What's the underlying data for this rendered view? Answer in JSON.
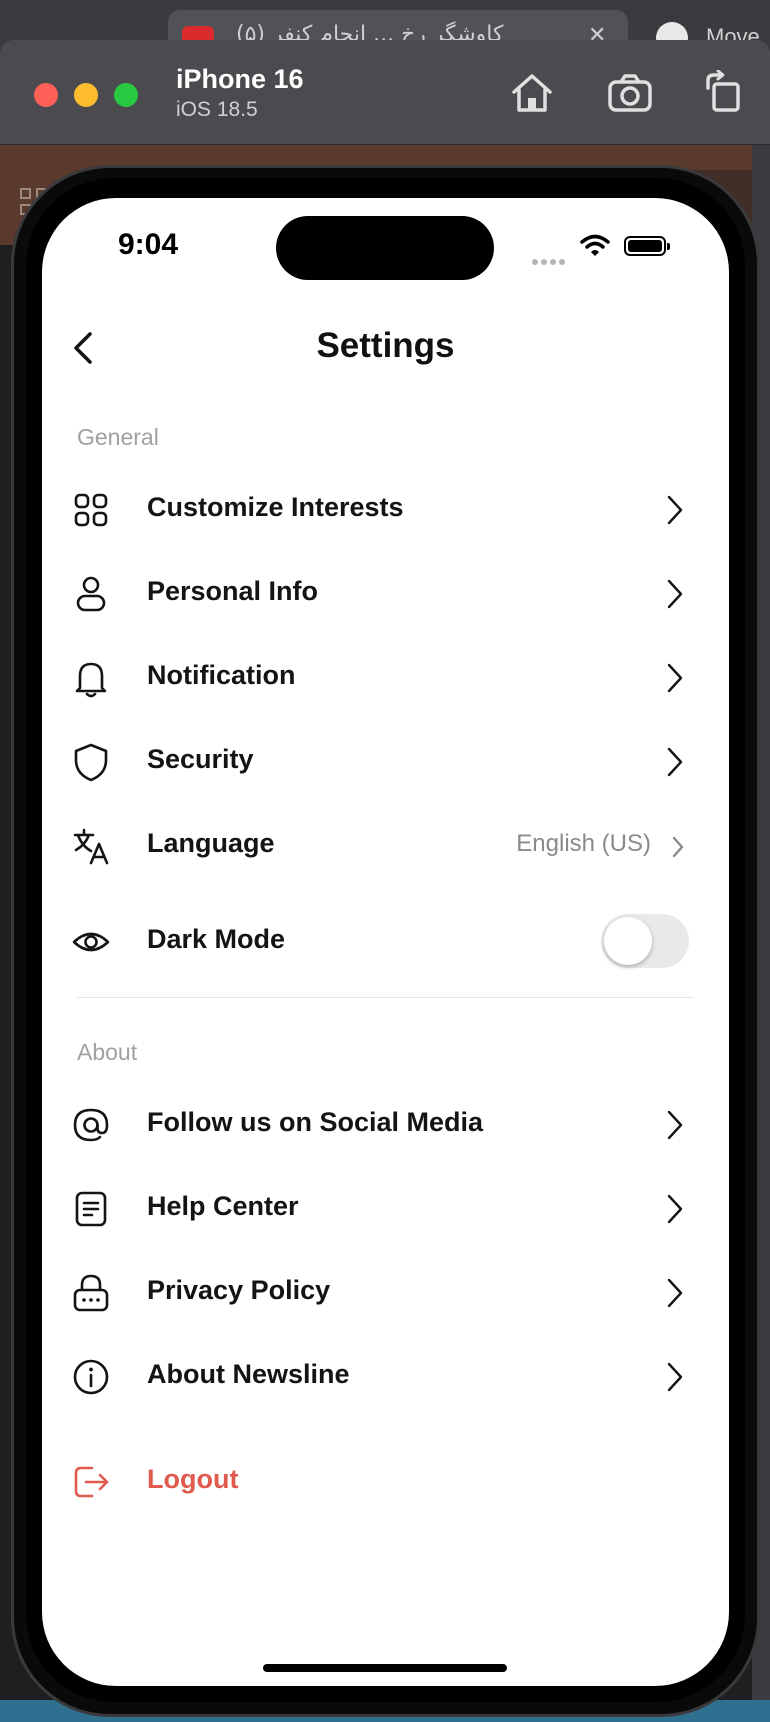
{
  "background": {
    "browser_tab_text": "(۵) کاوشگر رخ ... انجام کنفر",
    "browser_right_text": "Move"
  },
  "simulator": {
    "device_name": "iPhone 16",
    "os_version": "iOS 18.5",
    "toolbar_icons": [
      "home-icon",
      "screenshot-icon",
      "rotate-icon"
    ]
  },
  "status_bar": {
    "time": "9:04"
  },
  "nav": {
    "title": "Settings",
    "back_icon": "chevron-left-icon"
  },
  "sections": {
    "general": {
      "label": "General",
      "items": [
        {
          "label": "Customize Interests",
          "icon": "grid-icon"
        },
        {
          "label": "Personal Info",
          "icon": "person-icon"
        },
        {
          "label": "Notification",
          "icon": "bell-icon"
        },
        {
          "label": "Security",
          "icon": "shield-icon"
        },
        {
          "label": "Language",
          "icon": "translate-icon",
          "value": "English (US)"
        },
        {
          "label": "Dark Mode",
          "icon": "eye-icon",
          "toggle": false
        }
      ]
    },
    "about": {
      "label": "About",
      "items": [
        {
          "label": "Follow us on Social Media",
          "icon": "at-icon"
        },
        {
          "label": "Help Center",
          "icon": "document-icon"
        },
        {
          "label": "Privacy Policy",
          "icon": "lock-icon"
        },
        {
          "label": "About Newsline",
          "icon": "info-icon"
        }
      ]
    }
  },
  "logout": {
    "label": "Logout",
    "icon": "logout-icon"
  },
  "colors": {
    "accent_danger": "#e05a4e",
    "section_label": "#a0a0a4",
    "text_primary": "#141414"
  }
}
